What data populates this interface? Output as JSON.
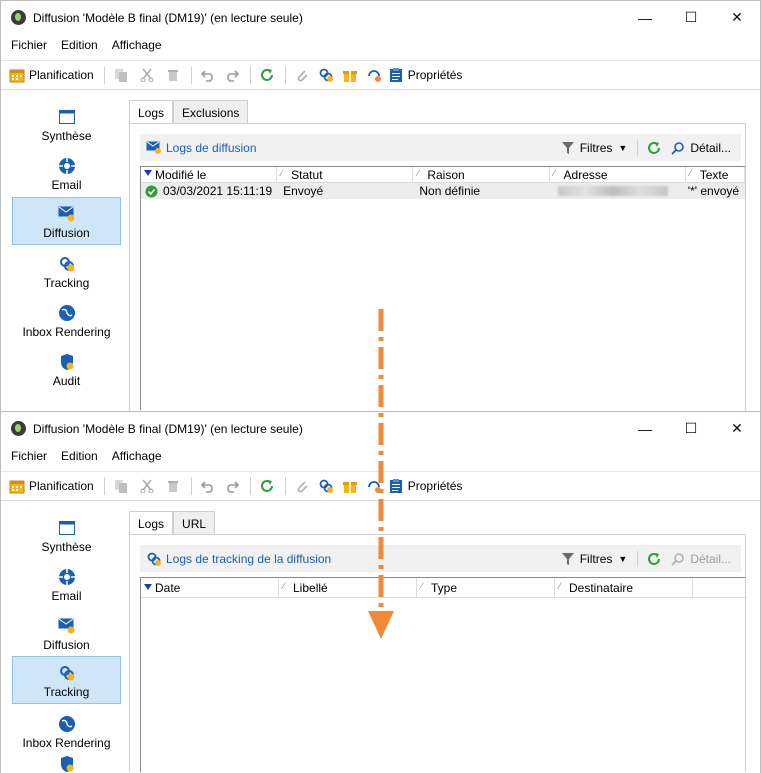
{
  "colors": {
    "accent": "#1a5fb4",
    "selected": "#cfe6f8",
    "arrow": "#f08a38",
    "refresh": "#2e9d3a"
  },
  "icons": {
    "toolbar": [
      "calendar-icon",
      "copy-icon",
      "cut-icon",
      "delete-icon",
      "undo-icon",
      "redo-icon",
      "refresh-icon",
      "attach-icon",
      "link-icon",
      "gift-icon",
      "cursor-icon",
      "clipboard-icon"
    ],
    "sidebar": [
      "summary-icon",
      "email-icon",
      "delivery-icon",
      "tracking-icon",
      "globe-icon",
      "audit-icon"
    ]
  },
  "window1": {
    "title": "Diffusion 'Modèle B final (DM19)' (en lecture seule)",
    "menu": [
      "Fichier",
      "Edition",
      "Affichage"
    ],
    "toolbar": {
      "planification": "Planification",
      "proprietes": "Propriétés"
    },
    "sidebar": [
      "Synthèse",
      "Email",
      "Diffusion",
      "Tracking",
      "Inbox Rendering",
      "Audit"
    ],
    "active_sidebar": "Diffusion",
    "tabs": [
      "Logs",
      "Exclusions"
    ],
    "header": {
      "title": "Logs de diffusion",
      "filters": "Filtres",
      "detail": "Détail..."
    },
    "columns": [
      "Modifié le",
      "Statut",
      "Raison",
      "Adresse",
      "Texte"
    ],
    "rows": [
      {
        "date": "03/03/2021 15:11:19",
        "statut": "Envoyé",
        "raison": "Non définie",
        "texte": "'*' envoyé"
      }
    ]
  },
  "window2": {
    "title": "Diffusion 'Modèle B final (DM19)' (en lecture seule)",
    "menu": [
      "Fichier",
      "Edition",
      "Affichage"
    ],
    "toolbar": {
      "planification": "Planification",
      "proprietes": "Propriétés"
    },
    "sidebar": [
      "Synthèse",
      "Email",
      "Diffusion",
      "Tracking",
      "Inbox Rendering"
    ],
    "active_sidebar": "Tracking",
    "tabs": [
      "Logs",
      "URL"
    ],
    "header": {
      "title": "Logs de tracking de la diffusion",
      "filters": "Filtres",
      "detail": "Détail..."
    },
    "columns": [
      "Date",
      "Libellé",
      "Type",
      "Destinataire"
    ]
  }
}
